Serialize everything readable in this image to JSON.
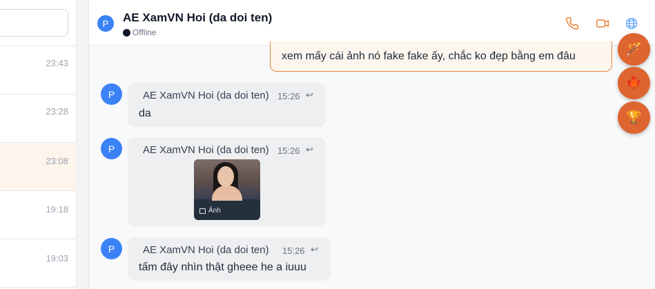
{
  "sidebar": {
    "conversations": [
      {
        "time": "23:43"
      },
      {
        "time": "23:28"
      },
      {
        "time": "23:08"
      },
      {
        "time": "19:18"
      },
      {
        "time": "19:03"
      }
    ]
  },
  "header": {
    "avatar_letter": "P",
    "title": "AE XamVN Hoi (da doi ten)",
    "status": "Offline",
    "icons": [
      "phone-icon",
      "video-icon",
      "globe-icon"
    ],
    "accent_color": "#e8833a"
  },
  "messages": {
    "outgoing": {
      "text": "xem mấy cái ảnh nó fake fake ấy, chắc ko đẹp bằng em đâu"
    },
    "incoming": [
      {
        "avatar": "P",
        "sender": "AE XamVN Hoi (da doi ten)",
        "time": "15:26",
        "text": "da"
      },
      {
        "avatar": "P",
        "sender": "AE XamVN Hoi (da doi ten)",
        "time": "15:26",
        "attachment_label": "Ảnh"
      },
      {
        "avatar": "P",
        "sender": "AE XamVN Hoi (da doi ten)",
        "time": "15:26",
        "text": "tấm đây nhìn thật gheee he a iuuu"
      }
    ],
    "reply_glyph": "↩"
  },
  "floating_buttons": [
    {
      "icon": "magic-wand-icon",
      "glyph": "🪄"
    },
    {
      "icon": "maple-leaf-icon",
      "glyph": "🍁"
    },
    {
      "icon": "trophy-icon",
      "glyph": "🏆"
    }
  ]
}
